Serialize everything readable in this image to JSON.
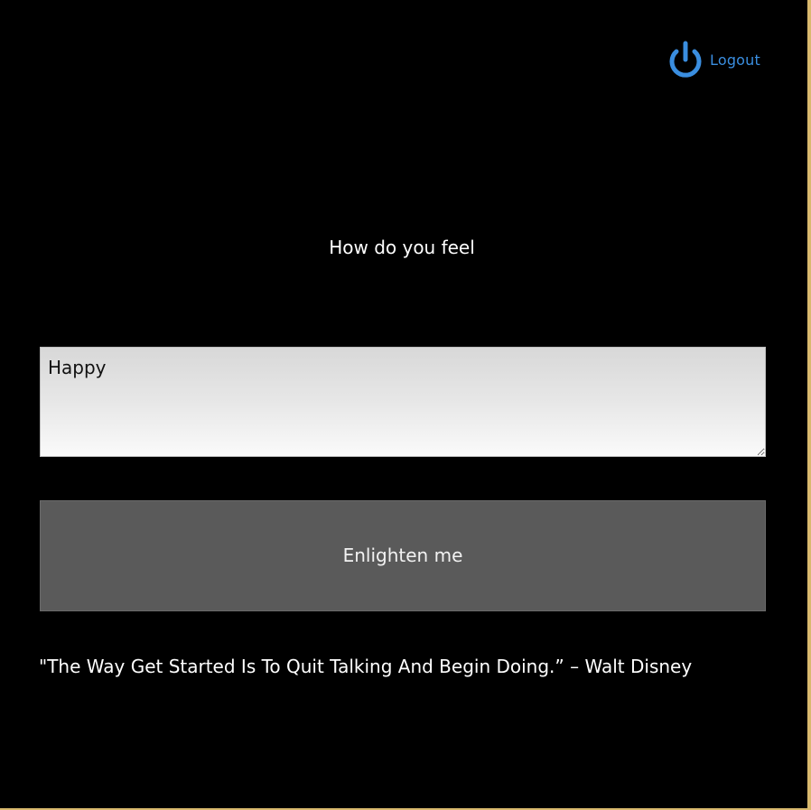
{
  "header": {
    "logout_label": "Logout",
    "logout_icon": "power-icon",
    "accent_color": "#3a8ee0"
  },
  "main": {
    "prompt": "How do you feel",
    "mood_input": {
      "value": "Happy",
      "placeholder": ""
    },
    "submit_label": "Enlighten me",
    "quote": "\"The Way Get Started Is To Quit Talking And Begin Doing.” – Walt Disney"
  },
  "colors": {
    "background": "#000000",
    "button": "#5a5a5a",
    "frame_border": "#d9b96e"
  }
}
